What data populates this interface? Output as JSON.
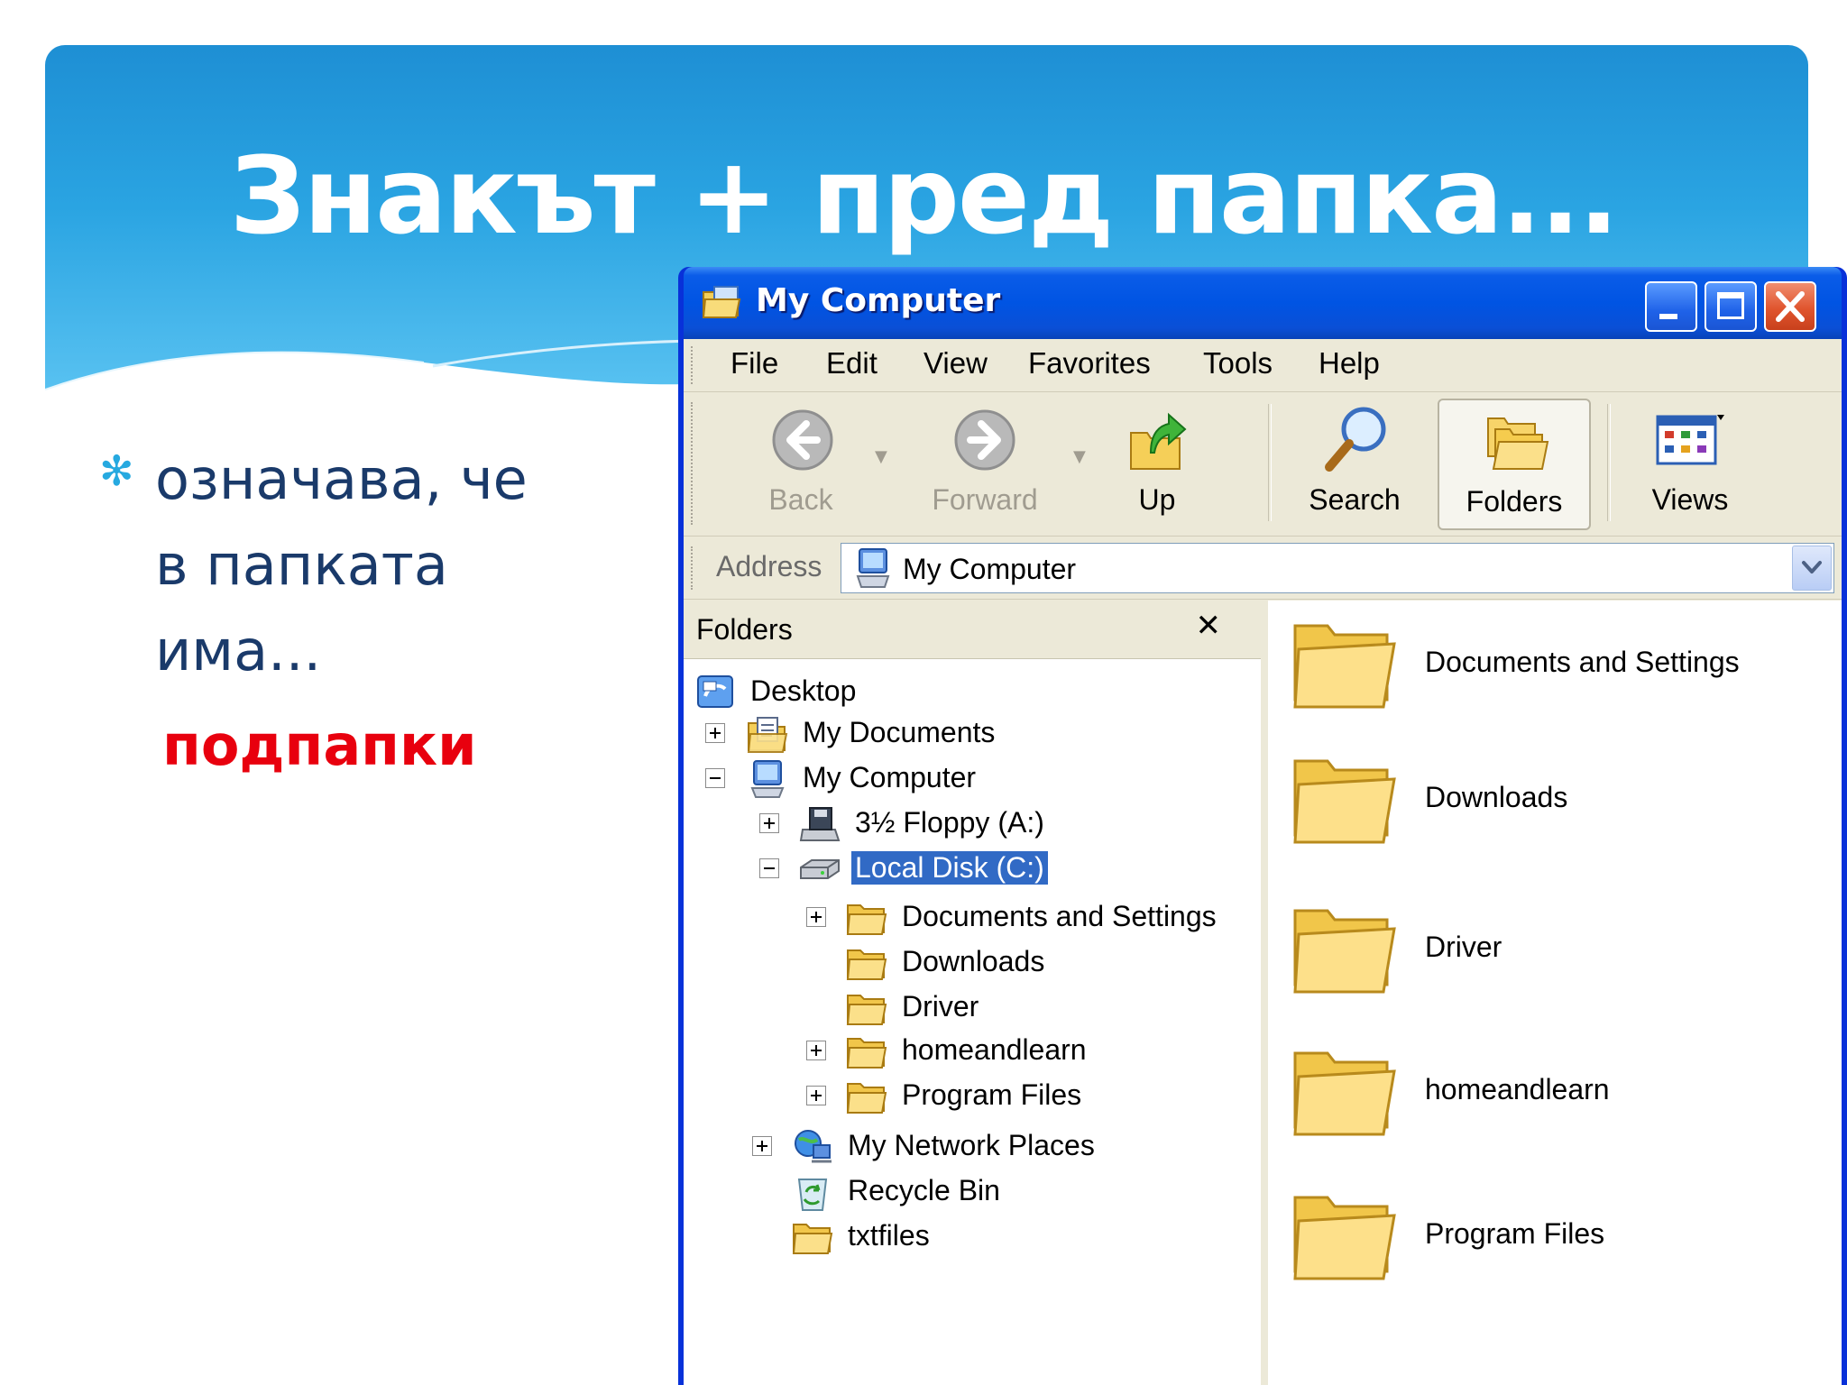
{
  "slide": {
    "title": "Знакът + пред папка...",
    "bullet": "означава, че в папката има...",
    "answer": "подпапки"
  },
  "window": {
    "title": "My Computer",
    "menu": [
      "File",
      "Edit",
      "View",
      "Favorites",
      "Tools",
      "Help"
    ],
    "toolbar": {
      "back": "Back",
      "forward": "Forward",
      "up": "Up",
      "search": "Search",
      "folders": "Folders",
      "views": "Views"
    },
    "address": {
      "label": "Address",
      "value": "My Computer"
    },
    "folders_pane": {
      "title": "Folders",
      "close": "✕",
      "tree": [
        {
          "label": "Desktop",
          "icon": "desktop-icon",
          "expander": "none"
        },
        {
          "label": "My Documents",
          "icon": "my-documents-icon",
          "expander": "plus"
        },
        {
          "label": "My Computer",
          "icon": "my-computer-icon",
          "expander": "minus"
        },
        {
          "label": "3½ Floppy (A:)",
          "icon": "floppy-drive-icon",
          "expander": "plus"
        },
        {
          "label": "Local Disk (C:)",
          "icon": "hard-disk-icon",
          "expander": "minus",
          "selected": true
        },
        {
          "label": "Documents and Settings",
          "icon": "folder-icon",
          "expander": "plus"
        },
        {
          "label": "Downloads",
          "icon": "folder-icon",
          "expander": "none"
        },
        {
          "label": "Driver",
          "icon": "folder-icon",
          "expander": "none"
        },
        {
          "label": "homeandlearn",
          "icon": "folder-icon",
          "expander": "plus"
        },
        {
          "label": "Program Files",
          "icon": "folder-icon",
          "expander": "plus"
        },
        {
          "label": "My Network Places",
          "icon": "network-places-icon",
          "expander": "plus"
        },
        {
          "label": "Recycle Bin",
          "icon": "recycle-bin-icon",
          "expander": "none"
        },
        {
          "label": "txtfiles",
          "icon": "folder-icon",
          "expander": "none"
        }
      ]
    },
    "content": [
      "Documents and Settings",
      "Downloads",
      "Driver",
      "homeandlearn",
      "Program Files"
    ]
  },
  "colors": {
    "banner": "#1e8fd4",
    "title_text": "#ffffff",
    "bullet_text": "#1a3a6a",
    "answer_text": "#e8000e",
    "xp_title_blue": "#0054e3",
    "selection": "#316ac5"
  }
}
